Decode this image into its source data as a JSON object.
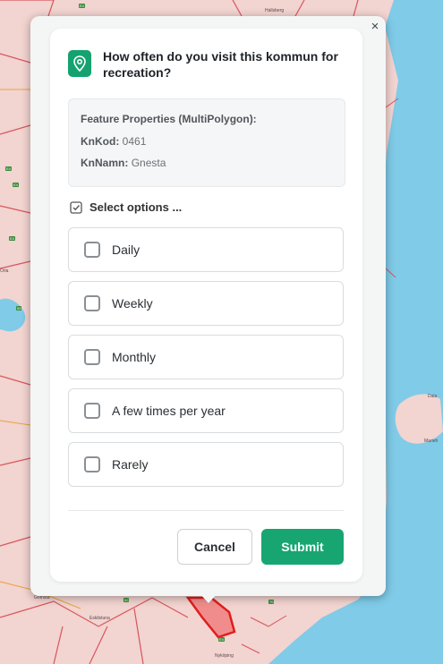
{
  "map": {
    "labels": [
      "Hallsberg",
      "Orla",
      "Grimsta",
      "Eskilstuna",
      "Nyköping",
      "Dala",
      "Marieh",
      "Gnesta"
    ],
    "road_badges": [
      "E4",
      "E4",
      "E4",
      "E4",
      "53",
      "52",
      "70",
      "E4",
      "E4"
    ]
  },
  "popup": {
    "close_label": "×",
    "question": "How often do you visit this kommun for recreation?",
    "properties": {
      "heading": "Feature Properties (MultiPolygon):",
      "rows": [
        {
          "key": "KnKod:",
          "value": "0461"
        },
        {
          "key": "KnNamn:",
          "value": "Gnesta"
        }
      ]
    },
    "select_label": "Select options ...",
    "options": [
      "Daily",
      "Weekly",
      "Monthly",
      "A few times per year",
      "Rarely"
    ],
    "cancel_label": "Cancel",
    "submit_label": "Submit"
  },
  "colors": {
    "accent": "#17a672",
    "land": "#f2d4d0",
    "water": "#7fcbe8",
    "border": "#d9545e",
    "highlight": "#e84040"
  }
}
